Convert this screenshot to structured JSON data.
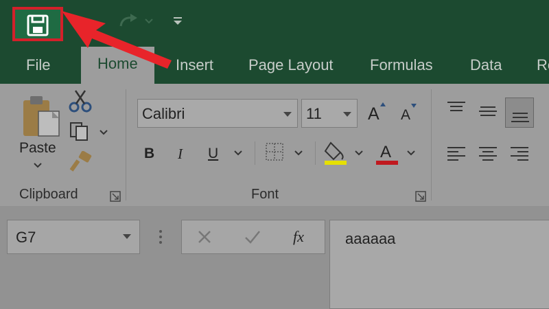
{
  "quick_access": {
    "save_icon": "save-icon",
    "undo_icon": "undo-icon",
    "redo_icon": "redo-icon",
    "customize_icon": "customize-quick-access-icon",
    "highlight_color": "#d3202a"
  },
  "tabs": [
    {
      "label": "File",
      "active": false
    },
    {
      "label": "Home",
      "active": true
    },
    {
      "label": "Insert",
      "active": false
    },
    {
      "label": "Page Layout",
      "active": false
    },
    {
      "label": "Formulas",
      "active": false
    },
    {
      "label": "Data",
      "active": false
    },
    {
      "label": "Re",
      "active": false
    }
  ],
  "clipboard": {
    "paste_label": "Paste",
    "group_label": "Clipboard",
    "cut_icon": "scissors-icon",
    "copy_icon": "copy-icon",
    "format_painter_icon": "format-painter-icon"
  },
  "font": {
    "group_label": "Font",
    "font_name": "Calibri",
    "font_size": "11",
    "bold": "B",
    "italic": "I",
    "underline": "U",
    "grow_font": "A",
    "shrink_font": "A",
    "font_color_letter": "A",
    "fill_color": "#e6e000",
    "font_color": "#c0191f"
  },
  "formula_bar": {
    "name_box": "G7",
    "cancel_icon": "x-icon",
    "enter_icon": "check-icon",
    "function_label": "fx",
    "content": "aaaaaa"
  },
  "colors": {
    "ribbon_green": "#1c4a30",
    "arrow_red": "#e8242a"
  }
}
